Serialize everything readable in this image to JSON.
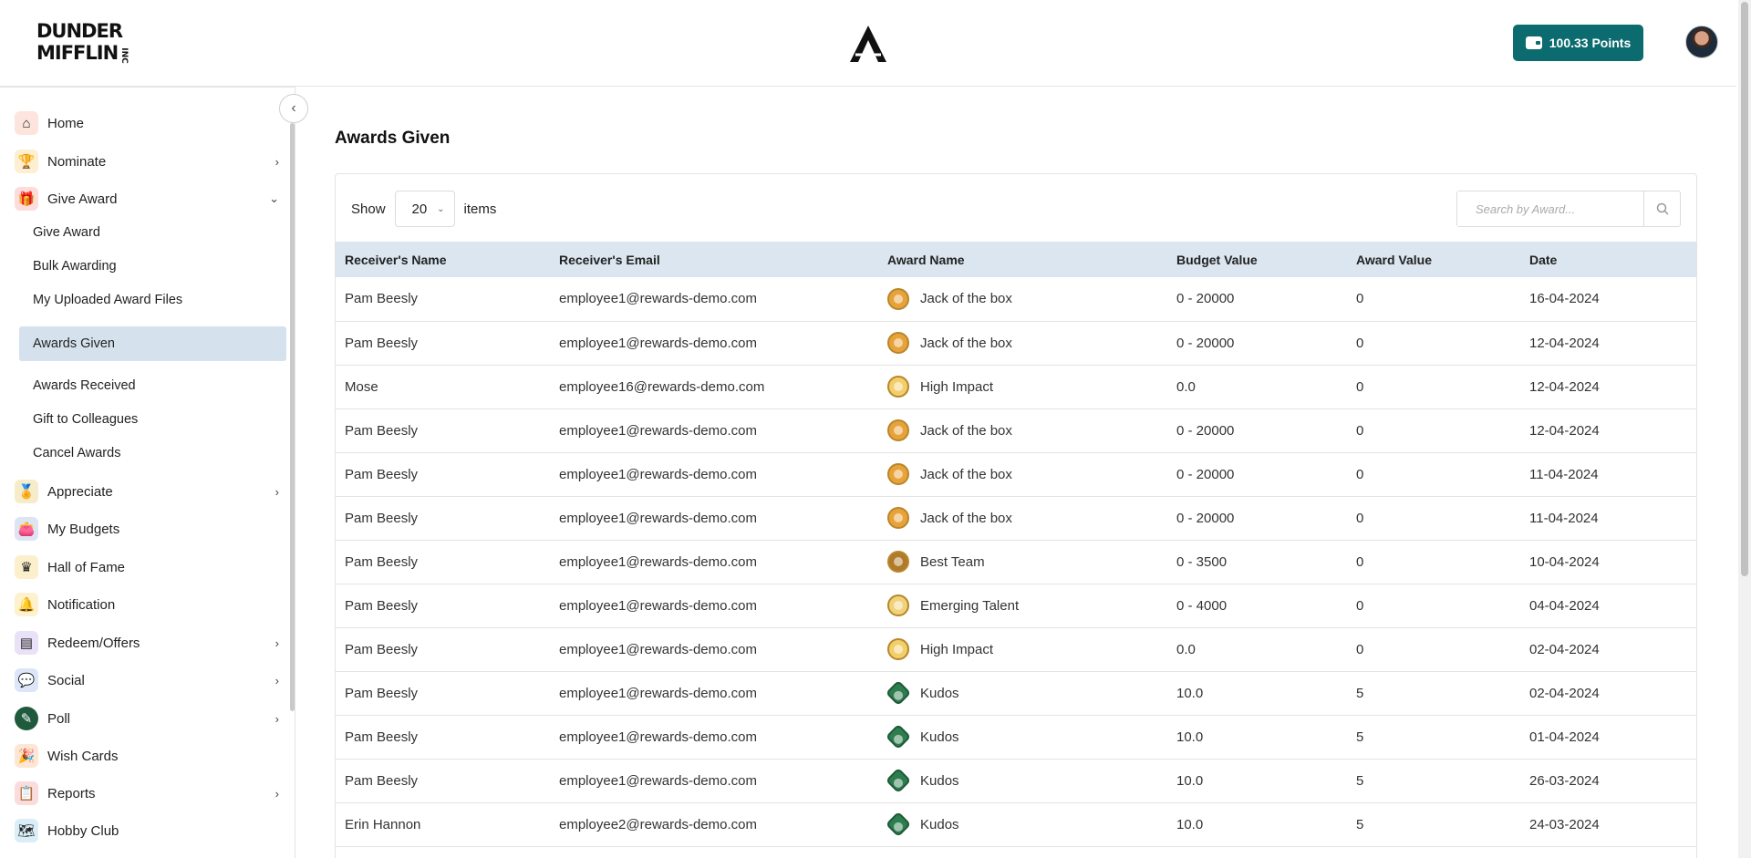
{
  "header": {
    "logo_line1": "DUNDER",
    "logo_line2": "MIFFLIN",
    "logo_suffix": "INC",
    "points_label": "100.33  Points",
    "accent_color": "#0c6b6e"
  },
  "sidebar": {
    "items": [
      {
        "label": "Home",
        "icon": "home-icon",
        "color": "#e85d3a"
      },
      {
        "label": "Nominate",
        "icon": "trophy-icon",
        "color": "#d99a1e"
      },
      {
        "label": "Give Award",
        "icon": "gift-icon",
        "color": "#e84b4b"
      },
      {
        "label": "Appreciate",
        "icon": "medal-icon",
        "color": "#c9a227"
      },
      {
        "label": "My Budgets",
        "icon": "wallet-icon",
        "color": "#3d5a9e"
      },
      {
        "label": "Hall of Fame",
        "icon": "crown-icon",
        "color": "#e8b21e"
      },
      {
        "label": "Notification",
        "icon": "bell-icon",
        "color": "#f0b429"
      },
      {
        "label": "Redeem/Offers",
        "icon": "redeem-icon",
        "color": "#8a6fcf"
      },
      {
        "label": "Social",
        "icon": "social-icon",
        "color": "#3e6fd8"
      },
      {
        "label": "Poll",
        "icon": "poll-icon",
        "color": "#1f5a3c"
      },
      {
        "label": "Wish Cards",
        "icon": "party-popper-icon",
        "color": "#f08c3a"
      },
      {
        "label": "Reports",
        "icon": "report-icon",
        "color": "#d9534f"
      },
      {
        "label": "Hobby Club",
        "icon": "map-icon",
        "color": "#4aa0c7"
      }
    ],
    "sub_items": [
      "Give Award",
      "Bulk Awarding",
      "My Uploaded Award Files",
      "Awards Given",
      "Awards Received",
      "Gift to Colleagues",
      "Cancel Awards"
    ],
    "active_sub": "Awards Given",
    "active_bg": "#d5e2ee"
  },
  "main": {
    "title": "Awards Given",
    "show_label": "Show",
    "page_size": "20",
    "items_label": "items",
    "search_placeholder": "Search by Award..."
  },
  "table": {
    "columns": [
      "Receiver's Name",
      "Receiver's Email",
      "Award Name",
      "Budget Value",
      "Award Value",
      "Date"
    ],
    "rows": [
      {
        "name": "Pam Beesly",
        "email": "employee1@rewards-demo.com",
        "award": "Jack of the box",
        "badge": "#e8a23a",
        "budget": "0 - 20000",
        "value": "0",
        "date": "16-04-2024"
      },
      {
        "name": "Pam Beesly",
        "email": "employee1@rewards-demo.com",
        "award": "Jack of the box",
        "badge": "#e8a23a",
        "budget": "0 - 20000",
        "value": "0",
        "date": "12-04-2024"
      },
      {
        "name": "Mose",
        "email": "employee16@rewards-demo.com",
        "award": "High Impact",
        "badge": "#f2cf6b",
        "budget": "0.0",
        "value": "0",
        "date": "12-04-2024"
      },
      {
        "name": "Pam Beesly",
        "email": "employee1@rewards-demo.com",
        "award": "Jack of the box",
        "badge": "#e8a23a",
        "budget": "0 - 20000",
        "value": "0",
        "date": "12-04-2024"
      },
      {
        "name": "Pam Beesly",
        "email": "employee1@rewards-demo.com",
        "award": "Jack of the box",
        "badge": "#e8a23a",
        "budget": "0 - 20000",
        "value": "0",
        "date": "11-04-2024"
      },
      {
        "name": "Pam Beesly",
        "email": "employee1@rewards-demo.com",
        "award": "Jack of the box",
        "badge": "#e8a23a",
        "budget": "0 - 20000",
        "value": "0",
        "date": "11-04-2024"
      },
      {
        "name": "Pam Beesly",
        "email": "employee1@rewards-demo.com",
        "award": "Best Team",
        "badge": "#b07a2a",
        "budget": "0 - 3500",
        "value": "0",
        "date": "10-04-2024"
      },
      {
        "name": "Pam Beesly",
        "email": "employee1@rewards-demo.com",
        "award": "Emerging Talent",
        "badge": "#f0d27a",
        "budget": "0 - 4000",
        "value": "0",
        "date": "04-04-2024"
      },
      {
        "name": "Pam Beesly",
        "email": "employee1@rewards-demo.com",
        "award": "High Impact",
        "badge": "#f2cf6b",
        "budget": "0.0",
        "value": "0",
        "date": "02-04-2024"
      },
      {
        "name": "Pam Beesly",
        "email": "employee1@rewards-demo.com",
        "award": "Kudos",
        "badge": "#2e7d4f",
        "budget": "10.0",
        "value": "5",
        "date": "02-04-2024"
      },
      {
        "name": "Pam Beesly",
        "email": "employee1@rewards-demo.com",
        "award": "Kudos",
        "badge": "#2e7d4f",
        "budget": "10.0",
        "value": "5",
        "date": "01-04-2024"
      },
      {
        "name": "Pam Beesly",
        "email": "employee1@rewards-demo.com",
        "award": "Kudos",
        "badge": "#2e7d4f",
        "budget": "10.0",
        "value": "5",
        "date": "26-03-2024"
      },
      {
        "name": "Erin Hannon",
        "email": "employee2@rewards-demo.com",
        "award": "Kudos",
        "badge": "#2e7d4f",
        "budget": "10.0",
        "value": "5",
        "date": "24-03-2024"
      }
    ]
  }
}
